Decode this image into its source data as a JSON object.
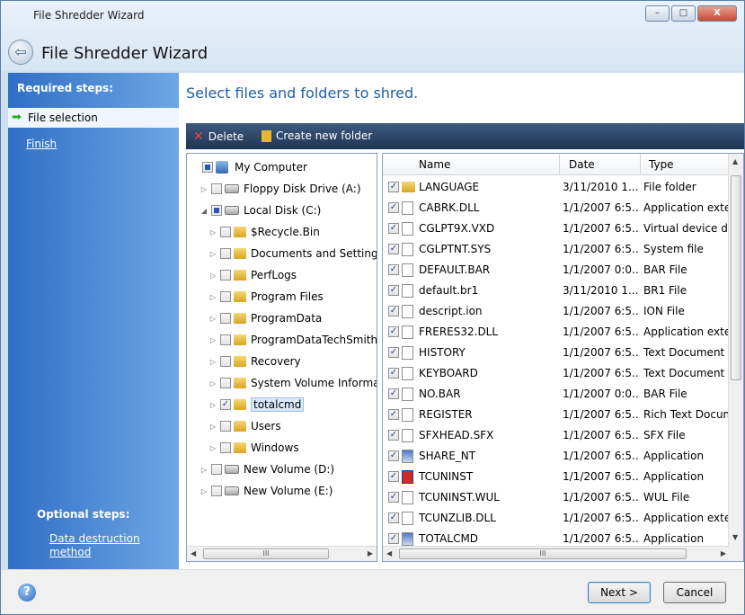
{
  "window": {
    "title": "File Shredder Wizard",
    "controls": {
      "minimize": "–",
      "maximize": "□",
      "close": "X"
    }
  },
  "wizard": {
    "title": "File Shredder Wizard",
    "back_icon": "back-arrow-icon"
  },
  "sidebar": {
    "required_heading": "Required steps:",
    "steps": [
      {
        "label": "File selection",
        "active": true
      },
      {
        "label": "Finish",
        "active": false
      }
    ],
    "optional_heading": "Optional steps:",
    "optional_link": "Data destruction method"
  },
  "main": {
    "heading": "Select files and folders to shred.",
    "toolbar": {
      "delete_label": "Delete",
      "new_folder_label": "Create new folder"
    }
  },
  "tree": [
    {
      "label": "My Computer",
      "icon": "computer-icon",
      "checked": "mixed",
      "expander": ""
    },
    {
      "label": "Floppy Disk Drive (A:)",
      "icon": "floppy-drive-icon",
      "checked": "none",
      "expander": "▷"
    },
    {
      "label": "Local Disk (C:)",
      "icon": "disk-icon",
      "checked": "mixed",
      "expander": "◢"
    },
    {
      "label": "$Recycle.Bin",
      "icon": "folder-icon",
      "checked": "none",
      "expander": "▷"
    },
    {
      "label": "Documents and Settings",
      "icon": "folder-icon",
      "checked": "none",
      "expander": "▷"
    },
    {
      "label": "PerfLogs",
      "icon": "folder-icon",
      "checked": "none",
      "expander": "▷"
    },
    {
      "label": "Program Files",
      "icon": "folder-icon",
      "checked": "none",
      "expander": "▷"
    },
    {
      "label": "ProgramData",
      "icon": "folder-icon",
      "checked": "none",
      "expander": "▷"
    },
    {
      "label": "ProgramDataTechSmith",
      "icon": "folder-icon",
      "checked": "none",
      "expander": "▷"
    },
    {
      "label": "Recovery",
      "icon": "folder-icon",
      "checked": "none",
      "expander": "▷"
    },
    {
      "label": "System Volume Information",
      "icon": "folder-icon",
      "checked": "none",
      "expander": "▷"
    },
    {
      "label": "totalcmd",
      "icon": "folder-icon",
      "checked": "checked",
      "expander": "▷",
      "selected": true
    },
    {
      "label": "Users",
      "icon": "folder-icon",
      "checked": "none",
      "expander": "▷"
    },
    {
      "label": "Windows",
      "icon": "folder-icon",
      "checked": "none",
      "expander": "▷"
    },
    {
      "label": "New Volume (D:)",
      "icon": "drive-icon",
      "checked": "none",
      "expander": "▷"
    },
    {
      "label": "New Volume (E:)",
      "icon": "drive-icon",
      "checked": "none",
      "expander": "▷"
    }
  ],
  "files": {
    "columns": {
      "name": "Name",
      "date": "Date",
      "type": "Type"
    },
    "rows": [
      {
        "name": "LANGUAGE",
        "date": "3/11/2010 1...",
        "type": "File folder",
        "icon": "folder-icon"
      },
      {
        "name": "CABRK.DLL",
        "date": "1/1/2007 6:5...",
        "type": "Application extension",
        "icon": "dll-icon"
      },
      {
        "name": "CGLPT9X.VXD",
        "date": "1/1/2007 6:5...",
        "type": "Virtual device driver",
        "icon": "dll-icon"
      },
      {
        "name": "CGLPTNT.SYS",
        "date": "1/1/2007 6:5...",
        "type": "System file",
        "icon": "dll-icon"
      },
      {
        "name": "DEFAULT.BAR",
        "date": "1/1/2007 0:0...",
        "type": "BAR File",
        "icon": "file-icon"
      },
      {
        "name": "default.br1",
        "date": "3/11/2010 1...",
        "type": "BR1 File",
        "icon": "file-icon"
      },
      {
        "name": "descript.ion",
        "date": "1/1/2007 6:5...",
        "type": "ION File",
        "icon": "file-icon"
      },
      {
        "name": "FRERES32.DLL",
        "date": "1/1/2007 6:5...",
        "type": "Application extension",
        "icon": "dll-icon"
      },
      {
        "name": "HISTORY",
        "date": "1/1/2007 6:5...",
        "type": "Text Document",
        "icon": "text-file-icon"
      },
      {
        "name": "KEYBOARD",
        "date": "1/1/2007 6:5...",
        "type": "Text Document",
        "icon": "text-file-icon"
      },
      {
        "name": "NO.BAR",
        "date": "1/1/2007 0:0...",
        "type": "BAR File",
        "icon": "file-icon"
      },
      {
        "name": "REGISTER",
        "date": "1/1/2007 6:5...",
        "type": "Rich Text Document",
        "icon": "rtf-icon"
      },
      {
        "name": "SFXHEAD.SFX",
        "date": "1/1/2007 6:5...",
        "type": "SFX File",
        "icon": "file-icon"
      },
      {
        "name": "SHARE_NT",
        "date": "1/1/2007 6:5...",
        "type": "Application",
        "icon": "app-icon"
      },
      {
        "name": "TCUNINST",
        "date": "1/1/2007 6:5...",
        "type": "Application",
        "icon": "uninstall-icon"
      },
      {
        "name": "TCUNINST.WUL",
        "date": "1/1/2007 6:5...",
        "type": "WUL File",
        "icon": "file-icon"
      },
      {
        "name": "TCUNZLIB.DLL",
        "date": "1/1/2007 6:5...",
        "type": "Application extension",
        "icon": "dll-icon"
      },
      {
        "name": "TOTALCMD",
        "date": "1/1/2007 6:5...",
        "type": "Application",
        "icon": "app-icon"
      }
    ]
  },
  "footer": {
    "help_icon": "?",
    "next_label": "Next >",
    "cancel_label": "Cancel"
  },
  "colors": {
    "sidebar": "#2f6fc4",
    "heading": "#1f5fa6",
    "toolbar": "#2a4468",
    "selection": "#d7e9fb"
  }
}
